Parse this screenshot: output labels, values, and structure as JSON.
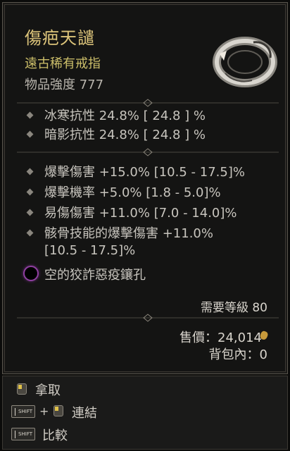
{
  "item": {
    "name": "傷疤天譴",
    "rarity": "遠古稀有戒指",
    "power": "物品強度 777"
  },
  "resist_stats": [
    "冰寒抗性 24.8%  [ 24.8 ] %",
    "暗影抗性 24.8%  [ 24.8 ] %"
  ],
  "affix_stats": [
    "爆擊傷害 +15.0% [10.5 - 17.5]%",
    "爆擊機率 +5.0% [1.8 - 5.0]%",
    "易傷傷害 +11.0% [7.0 - 14.0]%"
  ],
  "long_stat": {
    "line1": "骸骨技能的爆擊傷害 +11.0%",
    "line2": "[10.5 - 17.5]%"
  },
  "socket": "空的狡詐惡疫鑲孔",
  "requirement": "需要等級 80",
  "price": "售價：24,014",
  "bag": "背包內：0",
  "actions": {
    "take": "拿取",
    "link": "連結",
    "compare": "比較",
    "shift_key": "SHIFT",
    "plus": "+"
  },
  "colors": {
    "title": "#dcc47a",
    "rarity": "#cdbf6a",
    "socket_ring": "#8f3fa0"
  },
  "icons": [
    "ring-item-art",
    "diamond-bullet-icon",
    "socket-icon",
    "gold-coin-icon",
    "mouse-left-click-icon",
    "shift-key-icon"
  ]
}
